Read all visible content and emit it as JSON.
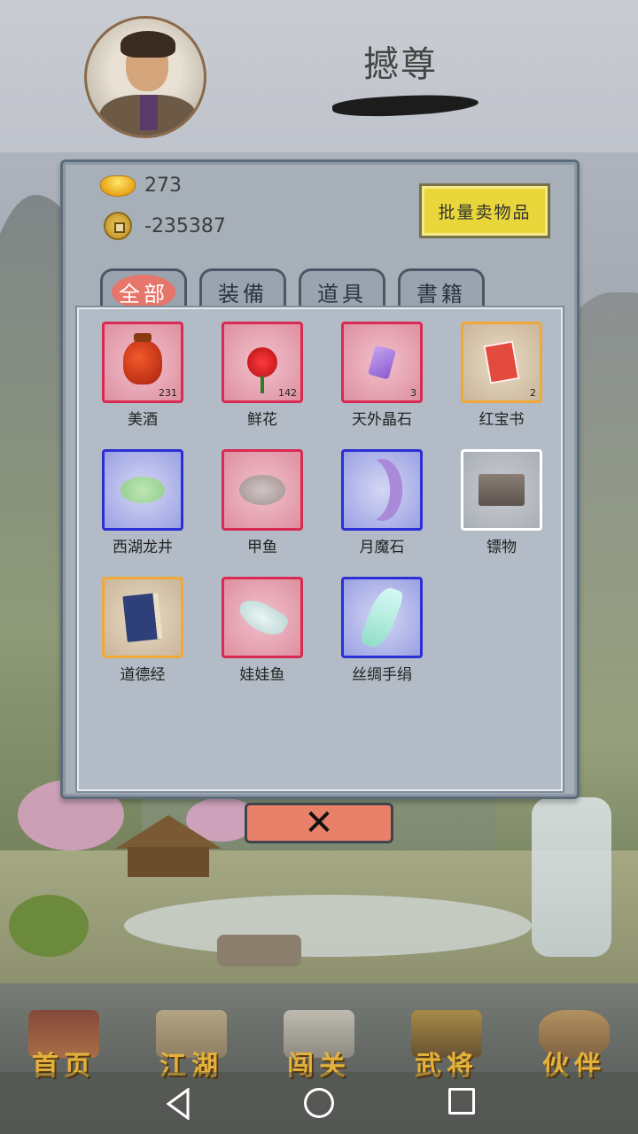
{
  "header": {
    "player_name": "撼尊",
    "avatar_icon": "avatar-portrait"
  },
  "currency": {
    "gold_value": "273",
    "copper_value": "-235387",
    "gold_icon": "gold-ingot-icon",
    "copper_icon": "copper-coin-icon"
  },
  "panel": {
    "sell_button_label": "批量卖物品",
    "tabs": [
      {
        "label": "全部",
        "active": true
      },
      {
        "label": "装備",
        "active": false
      },
      {
        "label": "道具",
        "active": false
      },
      {
        "label": "書籍",
        "active": false
      }
    ],
    "items": [
      {
        "name": "美酒",
        "count": "231",
        "rarity": "red"
      },
      {
        "name": "鲜花",
        "count": "142",
        "rarity": "red"
      },
      {
        "name": "天外晶石",
        "count": "3",
        "rarity": "red"
      },
      {
        "name": "红宝书",
        "count": "2",
        "rarity": "orange"
      },
      {
        "name": "西湖龙井",
        "count": "",
        "rarity": "blue"
      },
      {
        "name": "甲鱼",
        "count": "",
        "rarity": "red"
      },
      {
        "name": "月魔石",
        "count": "",
        "rarity": "blue"
      },
      {
        "name": "镖物",
        "count": "",
        "rarity": "white"
      },
      {
        "name": "道德经",
        "count": "",
        "rarity": "orange"
      },
      {
        "name": "娃娃鱼",
        "count": "",
        "rarity": "red"
      },
      {
        "name": "丝绸手绢",
        "count": "",
        "rarity": "blue"
      }
    ],
    "close_label": "✕"
  },
  "bottom_nav": [
    {
      "label": "首页",
      "icon": "pavilion-icon"
    },
    {
      "label": "江湖",
      "icon": "scroll-icon"
    },
    {
      "label": "闯关",
      "icon": "crossed-swords-icon"
    },
    {
      "label": "武将",
      "icon": "armor-icon"
    },
    {
      "label": "伙伴",
      "icon": "partners-icon"
    }
  ],
  "colors": {
    "rarity_red": "#d82a52",
    "rarity_blue": "#2c2fd6",
    "rarity_orange": "#f0a838",
    "rarity_white": "#ffffff",
    "sell_button": "#e9d63a",
    "close_button": "#e9806a",
    "nav_label": "#e3b23c"
  }
}
